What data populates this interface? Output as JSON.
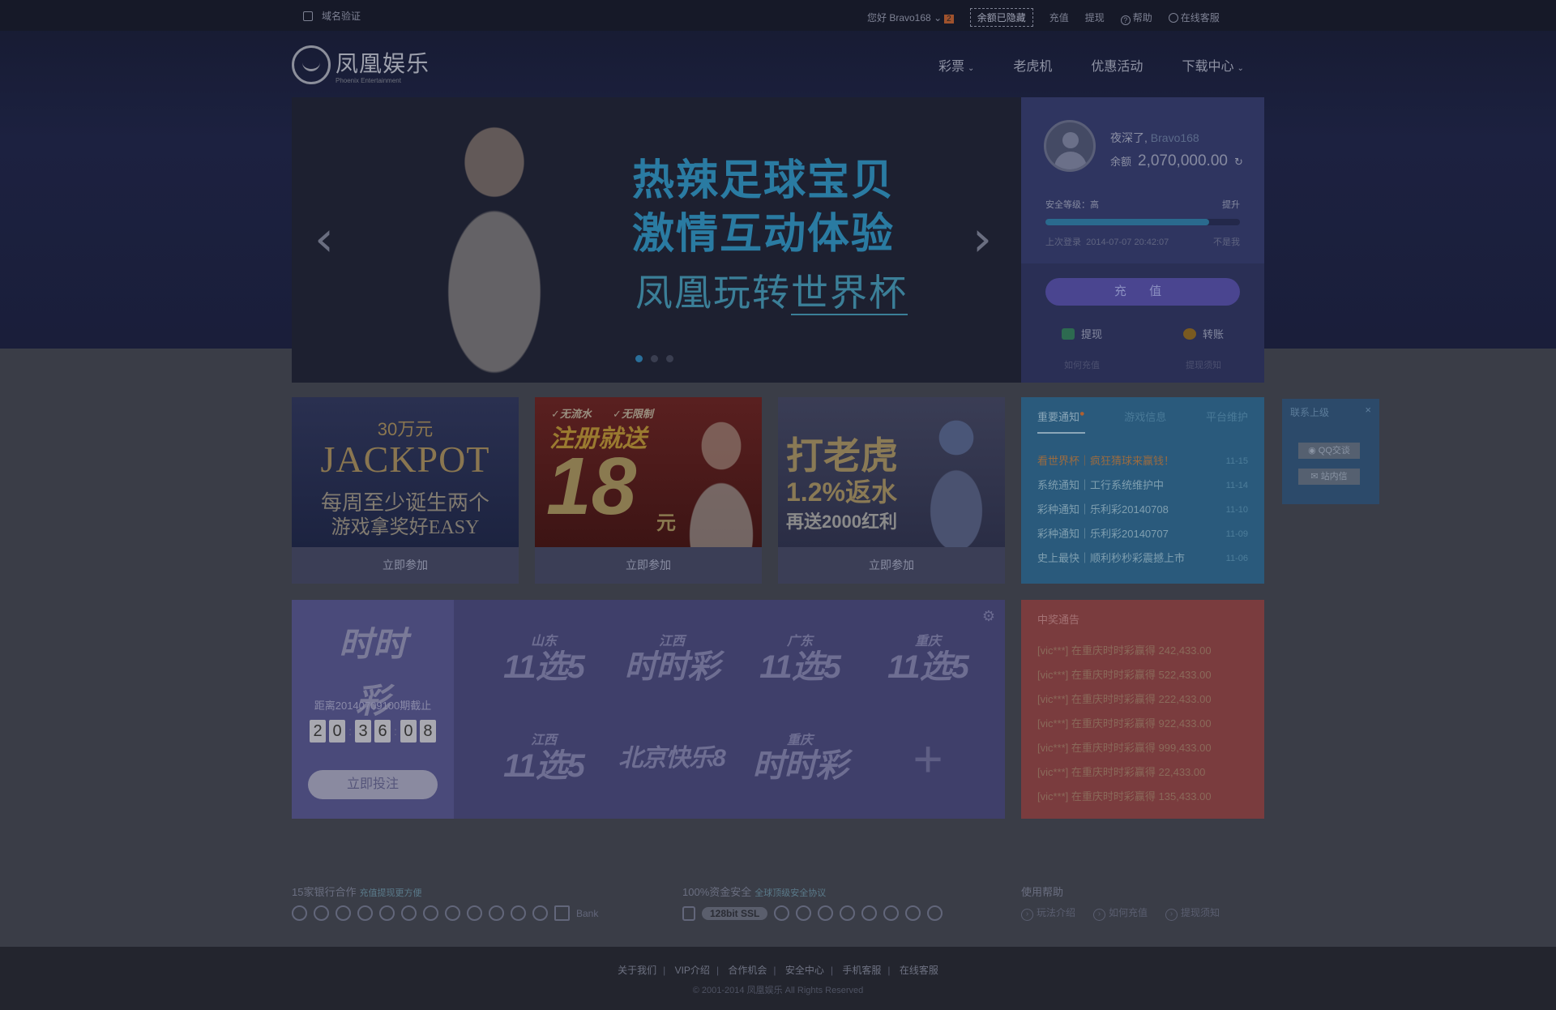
{
  "topbar": {
    "domain_verify": "域名验证",
    "greeting": "您好 Bravo168",
    "msg_count": "2",
    "balance_hidden": "余额已隐藏",
    "recharge": "充值",
    "withdraw": "提现",
    "help": "帮助",
    "service": "在线客服"
  },
  "logo": {
    "name": "凤凰娱乐",
    "sub": "Phoenix Entertainment"
  },
  "nav": [
    "彩票",
    "老虎机",
    "优惠活动",
    "下载中心"
  ],
  "banner": {
    "line1": "热辣足球宝贝",
    "line2": "激情互动体验",
    "line3a": "凤凰玩转",
    "line3b": "世界杯",
    "prev": "‹",
    "next": "›"
  },
  "user": {
    "greeting": "夜深了,",
    "name": "Bravo168",
    "balance_label": "余额",
    "balance": "2,070,000.00",
    "security_label": "安全等级：高",
    "security_up": "提升",
    "security_level": 0.84,
    "last_login_label": "上次登录",
    "last_login": "2014-07-07 20:42:07",
    "not_me": "不是我",
    "recharge_btn": "充 值",
    "withdraw": "提现",
    "transfer": "转账",
    "how_recharge": "如何充值",
    "withdraw_notice": "提现须知"
  },
  "promos": [
    {
      "a": "30万元",
      "b": "JACKPOT",
      "c": "每周至少诞生两个",
      "d": "游戏拿奖好EASY",
      "cta": "立即参加"
    },
    {
      "tag1": "无流水",
      "tag2": "无限制",
      "s1": "注册就送",
      "s2": "18",
      "s3": "元",
      "cta": "立即参加"
    },
    {
      "s1": "打老虎",
      "s2": "1.2%返水",
      "s3": "再送2000红利",
      "cta": "立即参加"
    }
  ],
  "notice": {
    "tabs": [
      "重要通知",
      "游戏信息",
      "平台维护"
    ],
    "items": [
      {
        "title": "看世界杯｜疯狂猜球来赢钱！",
        "date": "11-15"
      },
      {
        "title": "系统通知｜工行系统维护中",
        "date": "11-14"
      },
      {
        "title": "彩种通知｜乐利彩20140708",
        "date": "11-10"
      },
      {
        "title": "彩种通知｜乐利彩20140707",
        "date": "11-09"
      },
      {
        "title": "史上最快｜顺利秒秒彩震撼上市",
        "date": "11-06"
      }
    ]
  },
  "contact": {
    "title": "联系上级",
    "close": "×",
    "qq": "QQ交谈",
    "msg": "站内信"
  },
  "lottery": {
    "featured": "时时彩",
    "deadline": "距离20140709100期截止",
    "countdown": [
      "2",
      "0",
      "3",
      "6",
      "0",
      "8"
    ],
    "bet_btn": "立即投注",
    "tiles": [
      {
        "region": "山东",
        "name": "11选5"
      },
      {
        "region": "江西",
        "name": "时时彩"
      },
      {
        "region": "广东",
        "name": "11选5"
      },
      {
        "region": "重庆",
        "name": "11选5"
      },
      {
        "region": "江西",
        "name": "11选5"
      },
      {
        "region": "",
        "name": "北京快乐8"
      },
      {
        "region": "重庆",
        "name": "时时彩"
      },
      {
        "region": "",
        "name": "+"
      }
    ]
  },
  "winners": {
    "title": "中奖通告",
    "items": [
      "[vic***] 在重庆时时彩赢得 242,433.00",
      "[vic***] 在重庆时时彩赢得 522,433.00",
      "[vic***] 在重庆时时彩赢得 222,433.00",
      "[vic***] 在重庆时时彩赢得 922,433.00",
      "[vic***] 在重庆时时彩赢得 999,433.00",
      "[vic***] 在重庆时时彩赢得 22,433.00",
      "[vic***] 在重庆时时彩赢得 135,433.00"
    ]
  },
  "footinfo": {
    "banks_title": "15家银行合作",
    "banks_sub": "充值提现更方便",
    "bank_text": "Bank",
    "safety_title": "100%资金安全",
    "safety_sub": "全球顶级安全协议",
    "ssl": "128bit SSL",
    "help_title": "使用帮助",
    "help_links": [
      "玩法介绍",
      "如何充值",
      "提现须知"
    ]
  },
  "footer": {
    "links": [
      "关于我们",
      "VIP介绍",
      "合作机会",
      "安全中心",
      "手机客服",
      "在线客服"
    ],
    "copyright": "© 2001-2014 凤凰娱乐 All Rights Reserved"
  }
}
